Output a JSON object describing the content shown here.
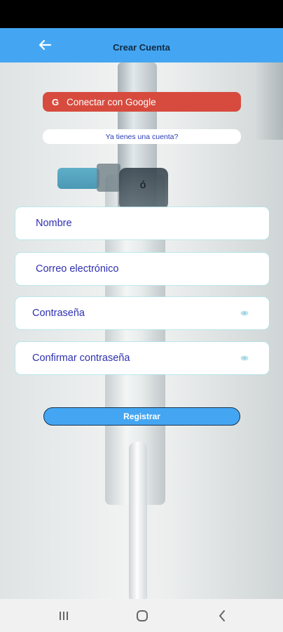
{
  "app_bar": {
    "title": "Crear Cuenta"
  },
  "google_button": {
    "label": "Conectar con Google",
    "icon_letter": "G"
  },
  "login_link": {
    "label": "Ya tienes una cuenta?"
  },
  "separator": "ó",
  "fields": {
    "nombre": {
      "placeholder": "Nombre"
    },
    "correo": {
      "placeholder": "Correo electrónico"
    },
    "contrasena": {
      "placeholder": "Contraseña"
    },
    "confirmar": {
      "placeholder": "Confirmar contraseña"
    }
  },
  "register_button": {
    "label": "Registrar"
  },
  "colors": {
    "app_bar": "#44a6f2",
    "google": "#d74b3e",
    "field_text": "#2f2fb1"
  },
  "icons": {
    "back": "arrow-left-icon",
    "eye": "eye-icon",
    "recents": "recents-icon",
    "home": "home-icon",
    "nav_back": "chevron-left-icon"
  }
}
